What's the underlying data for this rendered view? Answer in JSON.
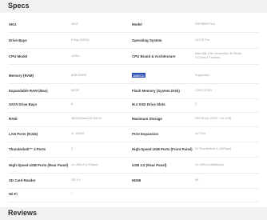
{
  "specs": {
    "title": "Specs",
    "rows": [
      {
        "left_label": "SKU",
        "left_value": "3928",
        "right_label": "Model",
        "right_value": "DXP8800 Plus"
      },
      {
        "left_label": "Drive Bays",
        "left_value": "8 Bay (SATA)",
        "right_label": "Operating System",
        "right_value": "UGOS Pro"
      },
      {
        "left_label": "CPU Model",
        "left_value": "1235u",
        "right_label": "CPU Brand & Architecture",
        "right_value": "Intel x86 12th Generation i5 Series\n4 Cores 4 Threads"
      },
      {
        "left_label": "Memory (RAM)",
        "left_value": "8GB DDR5",
        "right_label": "DDECC",
        "right_value": "Supported"
      },
      {
        "left_label": "Expandable RAM (Max)",
        "left_value": "64GB",
        "right_label": "Flash Memory (System Disk)",
        "right_value": "128G QSSD"
      },
      {
        "left_label": "SATA Drive Bays",
        "left_value": "8",
        "right_label": "M.2 SSD Drive Slots",
        "right_value": "2"
      },
      {
        "left_label": "RAID",
        "left_value": "JBOD/Basic/0/1/5/6/10",
        "right_label": "Maximum Storage",
        "right_value": "256TB (8x 24TB + 2x 4TB)"
      },
      {
        "left_label": "LAN Ports (RJ45)",
        "left_value": "2x 10GbE",
        "right_label": "PCIe Expansion",
        "right_value": "1x PCIe"
      },
      {
        "left_label": "Thunderbolt™ 4 Ports",
        "left_value": "2",
        "right_label": "High-Speed USB Ports (Front Panel)",
        "right_value": "2x Thunderbolt 4 (40Gbps)"
      },
      {
        "left_label": "High-Speed USB Ports (Rear Panel)",
        "left_value": "2x USB-A (10Gbps)",
        "right_label": "USB 2.0 (Rear Panel)",
        "right_value": "2x USB-A (480Mbps)"
      },
      {
        "left_label": "SD Card Reader",
        "left_value": "SD 4.0",
        "right_label": "HDMI",
        "right_value": "8K"
      },
      {
        "left_label": "Wi-Fi",
        "left_value": "/",
        "right_label": "",
        "right_value": ""
      }
    ]
  },
  "reviews": {
    "title": "Reviews"
  }
}
